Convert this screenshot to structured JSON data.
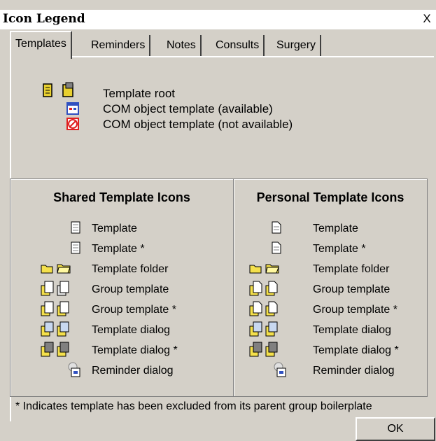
{
  "window": {
    "title": "Icon Legend",
    "close_label": "X"
  },
  "tabs": [
    {
      "label": "Templates",
      "active": true
    },
    {
      "label": "Reminders"
    },
    {
      "label": "Notes"
    },
    {
      "label": "Consults"
    },
    {
      "label": "Surgery"
    }
  ],
  "top_legend": [
    {
      "label": "Template root",
      "icon": "template-root-icon"
    },
    {
      "label": "COM object template (available)",
      "icon": "com-available-icon"
    },
    {
      "label": "COM object template (not available)",
      "icon": "com-unavailable-icon"
    }
  ],
  "shared": {
    "title": "Shared Template Icons",
    "items": [
      "Template",
      "Template *",
      "Template folder",
      "Group template",
      "Group template *",
      "Template dialog",
      "Template dialog *",
      "Reminder dialog"
    ]
  },
  "personal": {
    "title": "Personal Template Icons",
    "items": [
      "Template",
      "Template *",
      "Template folder",
      "Group template",
      "Group template *",
      "Template dialog",
      "Template dialog *",
      "Reminder dialog"
    ]
  },
  "footnote": "* Indicates template has been excluded from its parent group boilerplate",
  "ok_label": "OK",
  "colors": {
    "folder": "#f4e04c",
    "com_blue": "#3050c0",
    "com_red": "#e02020"
  }
}
